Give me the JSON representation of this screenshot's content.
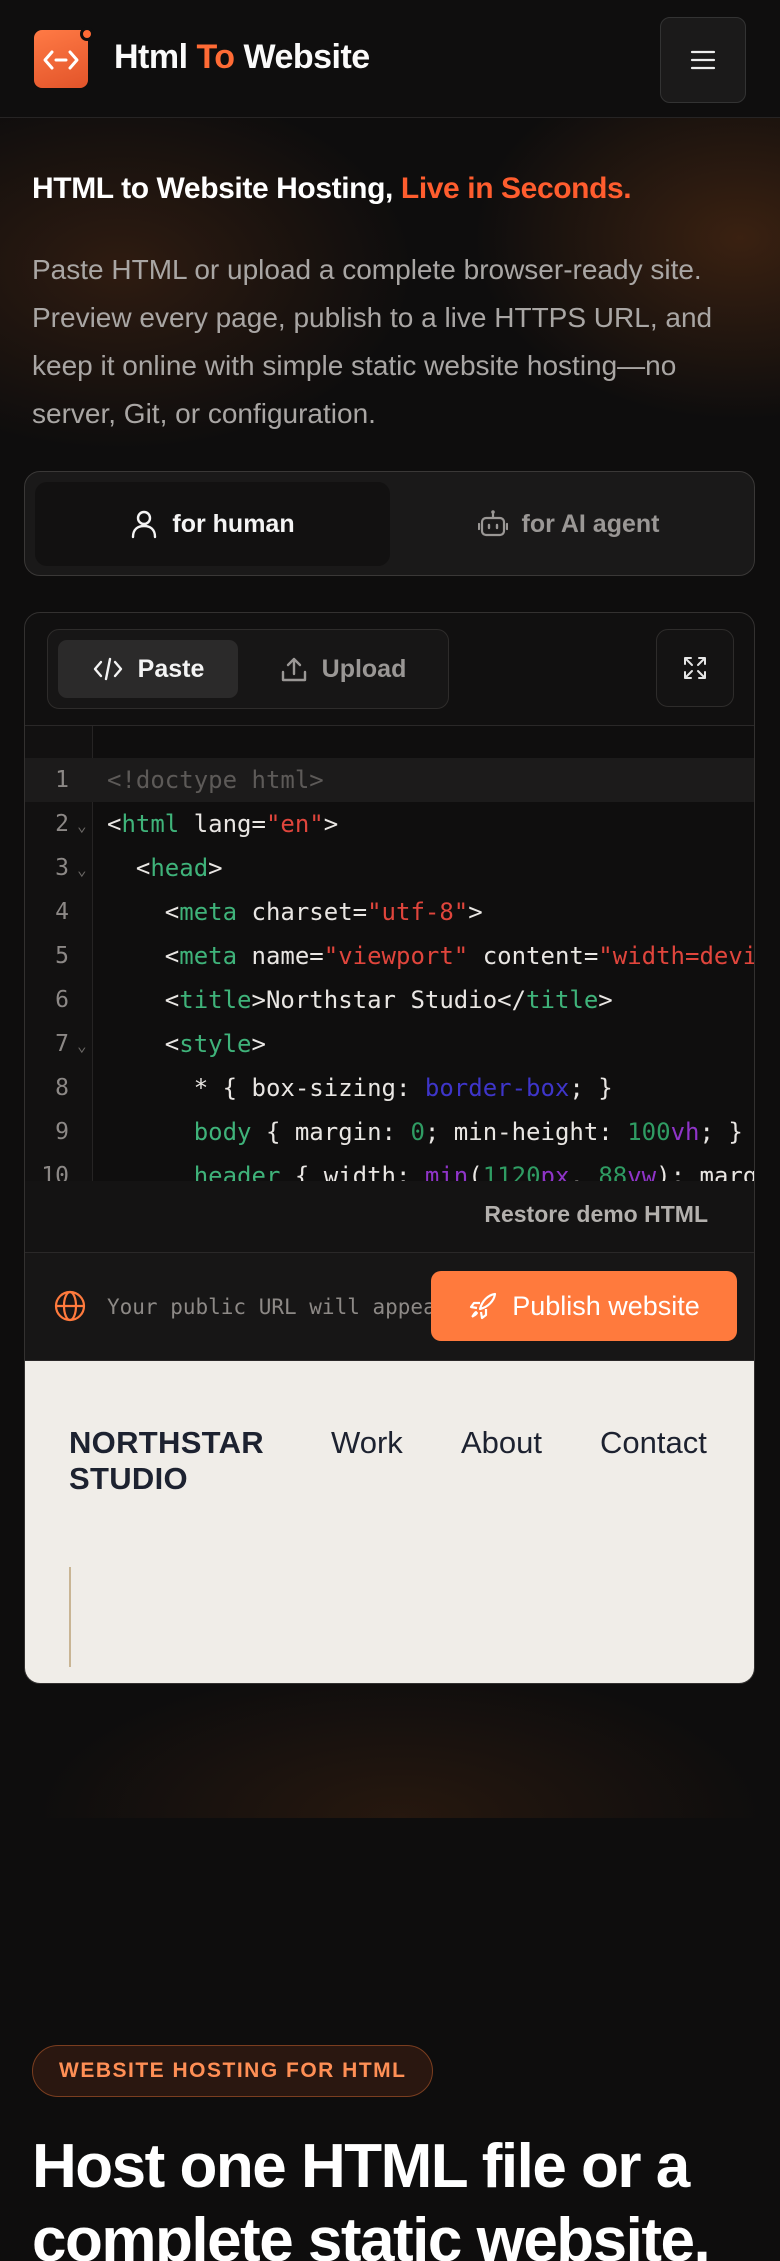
{
  "header": {
    "brand_part1": "Html ",
    "brand_accent": "To",
    "brand_part2": " Website",
    "menu_icon": "hamburger-menu-icon",
    "logo_icon": "code-brackets-icon"
  },
  "hero": {
    "title": "HTML to Website Hosting, ",
    "title_accent": "Live in Seconds.",
    "description": "Paste HTML or upload a complete browser-ready site. Preview every page, publish to a live HTTPS URL, and keep it online with simple static website hosting—no server, Git, or configuration."
  },
  "audience": {
    "human_label": "for human",
    "ai_label": "for AI agent"
  },
  "editor": {
    "tabs": [
      {
        "label": "Paste",
        "icon": "code-icon"
      },
      {
        "label": "Upload",
        "icon": "upload-icon"
      }
    ],
    "expand_icon": "expand-icon",
    "line_numbers": [
      "1",
      "2",
      "3",
      "4",
      "5",
      "6",
      "7",
      "8",
      "9",
      "10"
    ],
    "restore_label": "Restore demo HTML"
  },
  "publish": {
    "url_placeholder": "Your public URL will appear here",
    "button_label": "Publish website"
  },
  "preview": {
    "logo_line1": "NORTHSTAR",
    "logo_line2": "STUDIO",
    "nav": [
      "Work",
      "About",
      "Contact"
    ]
  },
  "section": {
    "badge": "WEBSITE HOSTING FOR HTML",
    "title": "Host one HTML file or a complete static website."
  },
  "colors": {
    "accent": "#ff6b35",
    "publish": "#ff7a3d",
    "background": "#0e0d0d"
  }
}
